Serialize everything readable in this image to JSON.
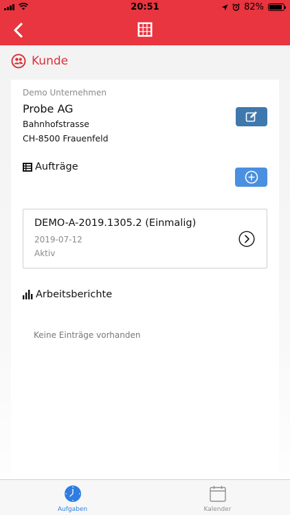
{
  "status_bar": {
    "time": "20:51",
    "battery": "82%"
  },
  "nav": {
    "back_icon": "chevron-left-icon",
    "menu_icon": "grid-icon"
  },
  "section": {
    "title": "Kunde",
    "icon": "users-icon"
  },
  "customer": {
    "company": "Demo Unternehmen",
    "name": "Probe AG",
    "address_line1": "Bahnhofstrasse",
    "address_line2": "CH-8500 Frauenfeld"
  },
  "orders": {
    "title": "Aufträge",
    "items": [
      {
        "title": "DEMO-A-2019.1305.2 (Einmalig)",
        "date": "2019-07-12",
        "status": "Aktiv"
      }
    ]
  },
  "reports": {
    "title": "Arbeitsberichte",
    "empty_text": "Keine Einträge vorhanden"
  },
  "tabs": [
    {
      "label": "Aufgaben",
      "icon": "clock-icon",
      "active": true
    },
    {
      "label": "Kalender",
      "icon": "calendar-icon",
      "active": false
    }
  ],
  "colors": {
    "primary": "#e8353f",
    "accent_red": "#d8323a",
    "edit_button": "#3f78ad",
    "add_button": "#4a8fe0",
    "tab_active": "#2f7de1",
    "tab_inactive": "#8e8e8e"
  }
}
